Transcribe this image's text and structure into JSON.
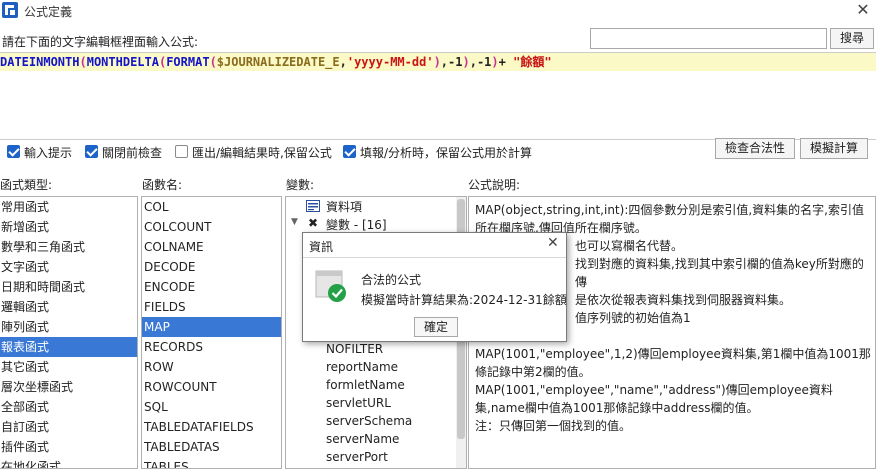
{
  "window": {
    "title": "公式定義"
  },
  "prompt": {
    "label": "請在下面的文字編輯框裡面輸入公式:"
  },
  "search": {
    "value": "",
    "button": "搜尋"
  },
  "editor": {
    "tokens": [
      {
        "t": "fn",
        "v": "DATEINMONTH"
      },
      {
        "t": "br",
        "v": "("
      },
      {
        "t": "fn",
        "v": "MONTHDELTA"
      },
      {
        "t": "br",
        "v": "("
      },
      {
        "t": "fn",
        "v": "FORMAT"
      },
      {
        "t": "br",
        "v": "("
      },
      {
        "t": "var",
        "v": "$JOURNALIZEDATE_E"
      },
      {
        "t": "op",
        "v": ","
      },
      {
        "t": "str",
        "v": "'yyyy-MM-dd'"
      },
      {
        "t": "br",
        "v": ")"
      },
      {
        "t": "op",
        "v": ",-1"
      },
      {
        "t": "br",
        "v": ")"
      },
      {
        "t": "op",
        "v": ",-1"
      },
      {
        "t": "br",
        "v": ")"
      },
      {
        "t": "op",
        "v": "+ "
      },
      {
        "t": "str",
        "v": "\"餘額\""
      }
    ]
  },
  "options": {
    "input_hint": "輸入提示",
    "close_check": "關閉前檢查",
    "keep_formula_export": "匯出/編輯結果時,保留公式",
    "keep_formula_fill": "填報/分析時，保留公式用於計算",
    "check_button": "檢查合法性",
    "simulate_button": "模擬計算"
  },
  "columns": {
    "type_header": "函式類型:",
    "name_header": "函數名:",
    "var_header": "變數:",
    "desc_header": "公式說明:"
  },
  "function_types": [
    "常用函式",
    "新增函式",
    "數學和三角函式",
    "文字函式",
    "日期和時間函式",
    "邏輯函式",
    "陣列函式",
    "報表函式",
    "其它函式",
    "層次坐標函式",
    "全部函式",
    "自訂函式",
    "插件函式",
    "在地化函式"
  ],
  "function_names": [
    "COL",
    "COLCOUNT",
    "COLNAME",
    "DECODE",
    "ENCODE",
    "FIELDS",
    "MAP",
    "RECORDS",
    "ROW",
    "ROWCOUNT",
    "SQL",
    "TABLEDATAFIELDS",
    "TABLEDATAS",
    "TABLES"
  ],
  "variables": {
    "datasource": "資料項",
    "params": "變數 - [16]",
    "items": [
      "NOFILTER",
      "reportName",
      "formletName",
      "servletURL",
      "serverSchema",
      "serverName",
      "serverPort"
    ]
  },
  "description": [
    "MAP(object,string,int,int):四個參數分別是索引值,資料集的名字,索引值所在欄序號,傳回值所在欄序號。",
    "也可以寫欄名代替。",
    "找到對應的資料集,找到其中索引欄的值為key所對應的傳",
    "是依次從報表資料集找到伺服器資料集。",
    "值序列號的初始值為1",
    "MAP(1001,\"employee\",1,2)傳回employee資料集,第1欄中值為1001那條記錄中第2欄的值。",
    "MAP(1001,\"employee\",\"name\",\"address\")傳回employee資料集,name欄中值為1001那條記錄中address欄的值。",
    "注：只傳回第一個找到的值。"
  ],
  "dialog": {
    "title": "資訊",
    "message": "合法的公式",
    "result": "模擬當時計算結果為:2024-12-31餘額",
    "ok": "確定"
  },
  "colors": {
    "selection": "#3a78d6",
    "editor_bg": "#fbf9c6",
    "checkbox": "#1e64c8"
  }
}
